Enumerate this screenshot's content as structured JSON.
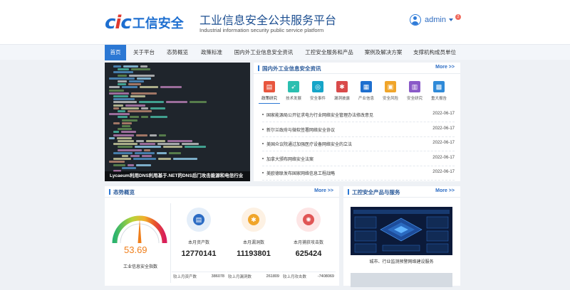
{
  "header": {
    "logo_text": "CIC工信安全",
    "title": "工业信息安全公共服务平台",
    "subtitle": "Industrial information security public service platform",
    "user_name": "admin",
    "badge_count": "2"
  },
  "nav": {
    "items": [
      {
        "label": "首页",
        "active": true
      },
      {
        "label": "关于平台"
      },
      {
        "label": "态势概览"
      },
      {
        "label": "政策标准"
      },
      {
        "label": "国内外工业信息安全资讯"
      },
      {
        "label": "工控安全服务和产品"
      },
      {
        "label": "案例及解决方案"
      },
      {
        "label": "支撑机构成员单位"
      }
    ]
  },
  "carousel": {
    "caption": "Lycaeum利用DNS利用基于.NET的DNS后门攻击能源和电信行业"
  },
  "news_panel": {
    "title": "国内外工业信息安全资讯",
    "more": "More >>",
    "categories": [
      {
        "label": "政策研究",
        "icon": "doc-icon",
        "color": "#e8563e"
      },
      {
        "label": "技术发展",
        "icon": "rocket-icon",
        "color": "#2bbfb0"
      },
      {
        "label": "安全事件",
        "icon": "alert-icon",
        "color": "#16a5c8"
      },
      {
        "label": "漏洞披露",
        "icon": "bug-icon",
        "color": "#d94a4a"
      },
      {
        "label": "产业信息",
        "icon": "chart-icon",
        "color": "#1e6fcf"
      },
      {
        "label": "安全风险",
        "icon": "lock-icon",
        "color": "#f0a52a"
      },
      {
        "label": "安全研究",
        "icon": "book-icon",
        "color": "#8a5ac8"
      },
      {
        "label": "重大报告",
        "icon": "report-icon",
        "color": "#2f8ad8"
      }
    ],
    "items": [
      {
        "text": "国家能源局公开征求电力行业网络安全管理办法修改意见",
        "date": "2022-06-17"
      },
      {
        "text": "新尔兰政府与微软签署网络安全协议",
        "date": "2022-06-17"
      },
      {
        "text": "美国众议院通过加强医疗设备网络安全的立法",
        "date": "2022-06-17"
      },
      {
        "text": "加拿大颁布网络安全法案",
        "date": "2022-06-17"
      },
      {
        "text": "美欧德联发布国家网络信息工程战略",
        "date": "2022-06-17"
      }
    ]
  },
  "situation_panel": {
    "title": "态势概览",
    "more": "More >>",
    "gauge_value": "53.69",
    "gauge_label": "工业信息安全指数",
    "stats": [
      {
        "label": "本月资产数",
        "value": "12770141",
        "foot_label": "较上月资产数",
        "foot_value": "386078",
        "color": "#e4eef9",
        "icon_color": "#2c6cc4"
      },
      {
        "label": "本月漏洞数",
        "value": "11193801",
        "foot_label": "较上月漏洞数",
        "foot_value": "261809",
        "color": "#fdf1e3",
        "icon_color": "#f0a52a"
      },
      {
        "label": "本月捕获攻击数",
        "value": "625424",
        "foot_label": "较上月攻击数",
        "foot_value": "-7408069",
        "color": "#fde5e5",
        "icon_color": "#e05555"
      }
    ]
  },
  "product_panel": {
    "title": "工控安全产品与服务",
    "more": "More >>",
    "caption": "城市、行业监测预警网络建设服务"
  }
}
